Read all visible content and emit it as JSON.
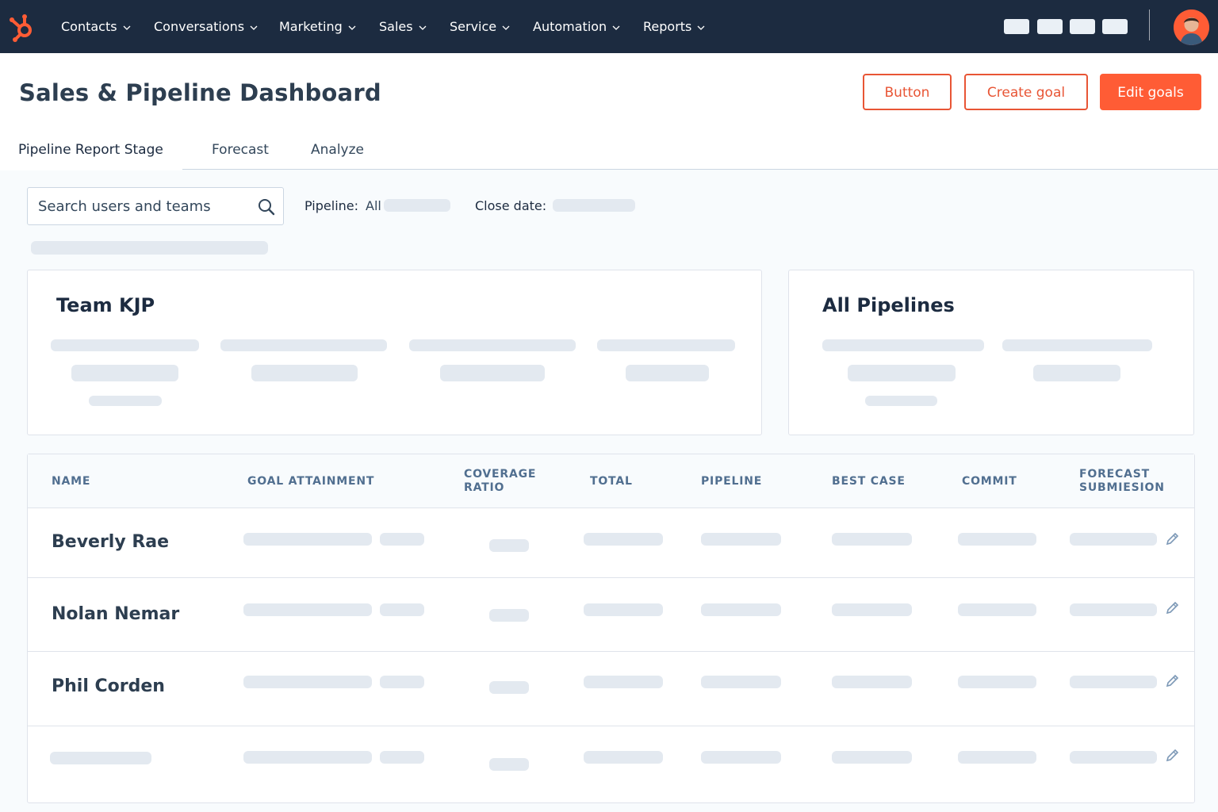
{
  "nav": {
    "items": [
      {
        "label": "Contacts"
      },
      {
        "label": "Conversations"
      },
      {
        "label": "Marketing"
      },
      {
        "label": "Sales"
      },
      {
        "label": "Service"
      },
      {
        "label": "Automation"
      },
      {
        "label": "Reports"
      }
    ]
  },
  "header": {
    "title": "Sales & Pipeline Dashboard",
    "buttons": {
      "button": "Button",
      "create_goal": "Create goal",
      "edit_goals": "Edit goals"
    }
  },
  "tabs": [
    {
      "label": "Pipeline Report Stage",
      "active": true
    },
    {
      "label": "Forecast"
    },
    {
      "label": "Analyze"
    }
  ],
  "filters": {
    "search_placeholder": "Search users and teams",
    "pipeline_label": "Pipeline:",
    "pipeline_value": "All",
    "close_date_label": "Close date:"
  },
  "cards": {
    "team": {
      "title": "Team KJP"
    },
    "pipelines": {
      "title": "All Pipelines"
    }
  },
  "table": {
    "columns": {
      "name": "NAME",
      "goal_attainment": "GOAL ATTAINMENT",
      "coverage_ratio_1": "COVERAGE",
      "coverage_ratio_2": "RATIO",
      "total": "TOTAL",
      "pipeline": "PIPELINE",
      "best_case": "BEST CASE",
      "commit": "COMMIT",
      "forecast_1": "FORECAST",
      "forecast_2": "SUBMIESION"
    },
    "rows": [
      {
        "name": "Beverly Rae"
      },
      {
        "name": "Nolan Nemar"
      },
      {
        "name": "Phil Corden"
      },
      {
        "name": ""
      }
    ]
  },
  "colors": {
    "nav_bg": "#1c2b40",
    "accent": "#ff5c35"
  }
}
